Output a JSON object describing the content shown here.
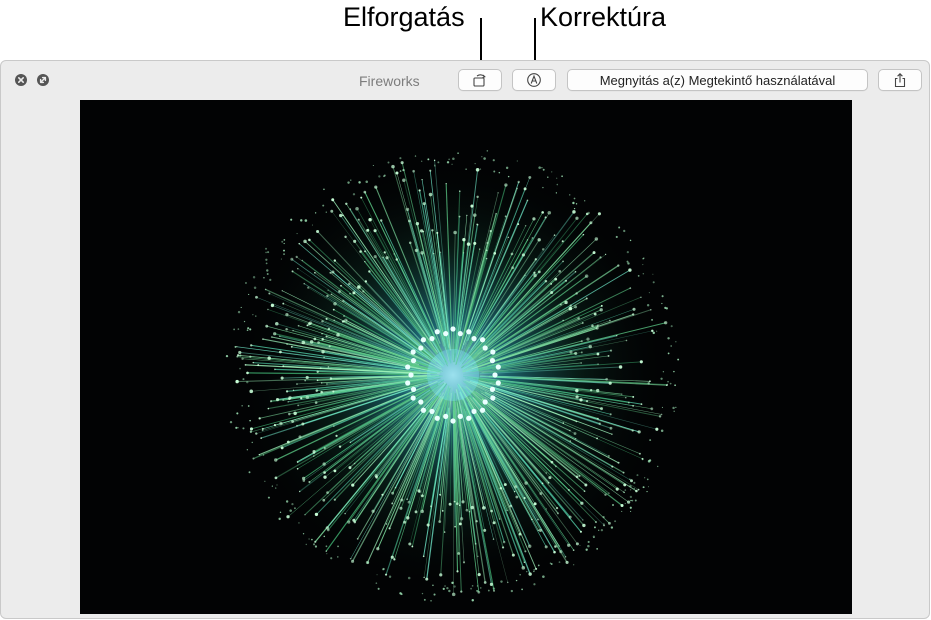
{
  "callouts": {
    "rotate": "Elforgatás",
    "markup": "Korrektúra"
  },
  "window": {
    "title": "Fireworks",
    "open_with_label": "Megnyitás a(z) Megtekintő használatával"
  },
  "icons": {
    "close": "close-icon",
    "fullscreen": "fullscreen-icon",
    "rotate": "rotate-icon",
    "markup": "markup-pen-icon",
    "share": "share-icon"
  },
  "colors": {
    "firework_green": "#5fd08a",
    "firework_cyan": "#7fe9ff",
    "background": "#020304"
  }
}
